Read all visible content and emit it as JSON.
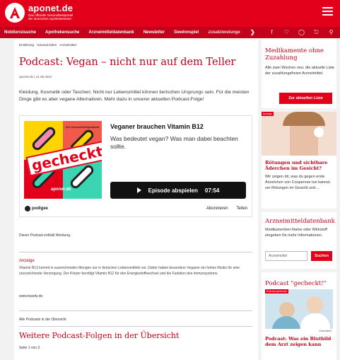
{
  "header": {
    "brand": "aponet.de",
    "brand_sub": "Das offizielle Gesundheitsportal der deutschen Apothekerinnen",
    "icon": "pharmacy-a-logo",
    "menu_icon": "hamburger-icon"
  },
  "nav": {
    "items": [
      "Notdienstsuche",
      "Apothekensuche",
      "Arzneimitteldatenbank",
      "Newsletter",
      "Gewinnspiel",
      "Zusatzleistungen"
    ],
    "more_icon": "chevron-right-icon",
    "social_icons": [
      "facebook-icon",
      "twitter-icon",
      "instagram-icon",
      "pinterest-icon",
      "search-icon"
    ]
  },
  "breadcrumb": [
    "Ernährung",
    "Gesund leben",
    "Arzneimittel"
  ],
  "article": {
    "title": "Podcast: Vegan – nicht nur auf dem Teller",
    "meta": "aponet.de | 21.06.2022",
    "lead": "Kleidung, Kosmetik oder Taschen: Nicht nur Lebensmittel können tierischen Ursprungs sein. Für die meisten Dinge gibt es aber vegane Alternativen. Mehr dazu in unserer aktuellen Podcast-Folge!"
  },
  "player": {
    "cover_label": "Der Gesundheitspodcast",
    "cover_stamp": "gecheckt!",
    "cover_brand": "aponet.de",
    "episode_title": "Veganer brauchen Vitamin B12",
    "episode_desc": "Was bedeutet vegan? Was man dabei beachten sollte.",
    "play_label": "Episode abspielen",
    "duration": "07:54",
    "provider": "podigee",
    "subscribe": "Abonnieren",
    "share": "Teilen"
  },
  "ad_note": "Dieser Podcast enthält Werbung.",
  "anzeige": {
    "label": "Anzeige",
    "text": "Vitamin B12 kommt in ausreichenden Mengen nur in tierischen Lebensmitteln vor. Daher haben besonders Veganer ein hohes Risiko für eine unzureichende Versorgung. Der Körper benötigt Vitamin B12 für den Energiestoffwechsel und die Funktion des Immunsystems.",
    "link": "www.twardy.de"
  },
  "all_podcasts": "Alle Podcasts in der Übersicht",
  "more_title": "Weitere Podcast-Folgen in der Übersicht",
  "page_info": "Seite 1 von 2.",
  "sidebar": {
    "box1": {
      "title": "Medikamente ohne Zuzahlung",
      "text": "Alle zwei Wochen neu: die aktuelle Liste der zuzahlungsfreien Arzneimittel.",
      "button": "Zur aktuellen Liste"
    },
    "ad": {
      "label": "Anzeige",
      "title": "Rötungen und sichtbare Äder­chen im Gesicht?",
      "text": "Wir zeigen dir, was du gegen erste Anzeichen von Couperose tun kannst, um Rötungen im Gesicht und...."
    },
    "db": {
      "title": "Arzneimitteldatenbank",
      "text": "Medikamenten-Name oder Wirkstoff eingeben für mehr Informationen.",
      "placeholder": "Arzneimittel",
      "button": "Suchen"
    },
    "podcast": {
      "title": "Podcast \"gecheckt!\"",
      "badge": "Podcast gecheckt!",
      "credit": "Gesundheit",
      "item": "Podcast: Was ein Blutbild dem Arzt zeigen kann"
    }
  },
  "colors": {
    "accent": "#e3001b",
    "dark_red": "#c4001a"
  }
}
